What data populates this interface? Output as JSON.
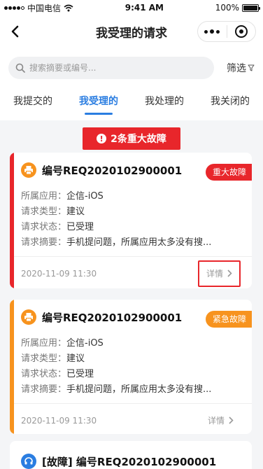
{
  "status_bar": {
    "carrier": "中国电信",
    "time": "9:41 AM",
    "battery": "100%",
    "battery_level": 1.0
  },
  "nav": {
    "title": "我受理的请求"
  },
  "search": {
    "placeholder": "搜索摘要或编号...",
    "value": "",
    "filter_label": "筛选"
  },
  "tabs": [
    {
      "label": "我提交的"
    },
    {
      "label": "我受理的"
    },
    {
      "label": "我处理的"
    },
    {
      "label": "我关闭的"
    }
  ],
  "alert": {
    "text": "2条重大故障",
    "icon": "!"
  },
  "cards": [
    {
      "title": "编号REQ2020102900001",
      "tag": "重大故障",
      "app_label": "所属应用：",
      "app": "企信-iOS",
      "type_label": "请求类型：",
      "type": "建议",
      "status_label": "请求状态：",
      "status": "已受理",
      "summary_label": "请求摘要：",
      "summary": "手机提问题，所属应用太多没有搜...",
      "time": "2020-11-09  11:30",
      "detail_label": "详情",
      "icon": "printer-icon",
      "accent": "#e8262b"
    },
    {
      "title": "编号REQ2020102900001",
      "tag": "紧急故障",
      "app_label": "所属应用：",
      "app": "企信-iOS",
      "type_label": "请求类型：",
      "type": "建议",
      "status_label": "请求状态：",
      "status": "已受理",
      "summary_label": "请求摘要：",
      "summary": "手机提问题，所属应用太多没有搜...",
      "time": "2020-11-09  11:30",
      "detail_label": "详情",
      "icon": "printer-icon",
      "accent": "#f7931e"
    },
    {
      "title": "[故障] 编号REQ2020102900001",
      "icon": "headset-icon",
      "accent": "#2a7de1"
    }
  ]
}
